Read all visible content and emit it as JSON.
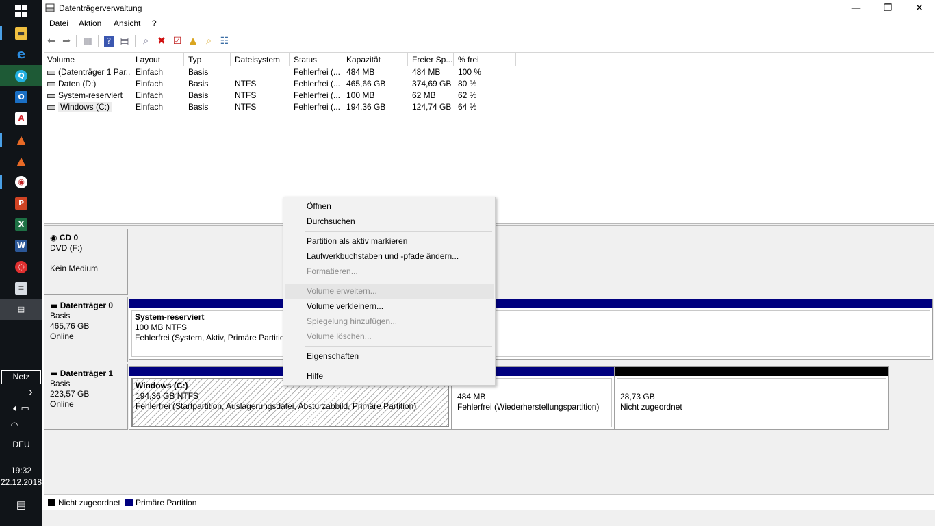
{
  "window": {
    "title": "Datenträgerverwaltung"
  },
  "menu": [
    "Datei",
    "Aktion",
    "Ansicht",
    "?"
  ],
  "list": {
    "columns": [
      "Volume",
      "Layout",
      "Typ",
      "Dateisystem",
      "Status",
      "Kapazität",
      "Freier Sp...",
      "% frei"
    ],
    "rows": [
      {
        "volume": "(Datenträger 1 Par...",
        "layout": "Einfach",
        "typ": "Basis",
        "fs": "",
        "status": "Fehlerfrei (...",
        "capacity": "484 MB",
        "free": "484 MB",
        "pct": "100 %"
      },
      {
        "volume": "Daten (D:)",
        "layout": "Einfach",
        "typ": "Basis",
        "fs": "NTFS",
        "status": "Fehlerfrei (...",
        "capacity": "465,66 GB",
        "free": "374,69 GB",
        "pct": "80 %"
      },
      {
        "volume": "System-reserviert",
        "layout": "Einfach",
        "typ": "Basis",
        "fs": "NTFS",
        "status": "Fehlerfrei (...",
        "capacity": "100 MB",
        "free": "62 MB",
        "pct": "62 %"
      },
      {
        "volume": "Windows (C:)",
        "layout": "Einfach",
        "typ": "Basis",
        "fs": "NTFS",
        "status": "Fehlerfrei (...",
        "capacity": "194,36 GB",
        "free": "124,74 GB",
        "pct": "64 %"
      }
    ]
  },
  "disks": {
    "cd0": {
      "name": "CD 0",
      "type": "DVD (F:)",
      "status": "Kein Medium"
    },
    "disk0": {
      "name": "Datenträger 0",
      "type": "Basis",
      "size": "465,76 GB",
      "status": "Online",
      "p1": {
        "name": "System-reserviert",
        "size": "100 MB NTFS",
        "status": "Fehlerfrei (System, Aktiv, Primäre Partition)"
      }
    },
    "disk1": {
      "name": "Datenträger 1",
      "type": "Basis",
      "size": "223,57 GB",
      "status": "Online",
      "p1": {
        "name": "Windows  (C:)",
        "size": "194,36 GB NTFS",
        "status": "Fehlerfrei (Startpartition, Auslagerungsdatei, Absturzabbild, Primäre Partition)"
      },
      "p2": {
        "size": "484 MB",
        "status": "Fehlerfrei (Wiederherstellungspartition)"
      },
      "p3": {
        "size": "28,73 GB",
        "status": "Nicht zugeordnet"
      }
    }
  },
  "legend": {
    "unallocated": "Nicht zugeordnet",
    "primary": "Primäre Partition"
  },
  "colors": {
    "primary": "#00007f",
    "unallocated": "#000000",
    "taskbar": "#101418"
  },
  "context_menu": {
    "items": [
      {
        "label": "Öffnen",
        "enabled": true
      },
      {
        "label": "Durchsuchen",
        "enabled": true
      },
      {
        "label": "Partition als aktiv markieren",
        "enabled": true
      },
      {
        "label": "Laufwerkbuchstaben und -pfade ändern...",
        "enabled": true
      },
      {
        "label": "Formatieren...",
        "enabled": false
      },
      {
        "label": "Volume erweitern...",
        "enabled": false,
        "highlighted": true
      },
      {
        "label": "Volume verkleinern...",
        "enabled": true
      },
      {
        "label": "Spiegelung hinzufügen...",
        "enabled": false
      },
      {
        "label": "Volume löschen...",
        "enabled": false
      },
      {
        "label": "Eigenschaften",
        "enabled": true
      },
      {
        "label": "Hilfe",
        "enabled": true
      }
    ]
  },
  "taskbar": {
    "network_label": "Netz",
    "language": "DEU",
    "time": "19:32",
    "date": "22.12.2018",
    "apps": [
      "windows-start-icon",
      "file-explorer-icon",
      "edge-icon",
      "app-q-icon",
      "outlook-icon",
      "acrobat-icon",
      "matlab-icon",
      "matlab-icon-2",
      "paint-icon",
      "powerpoint-icon",
      "excel-icon",
      "word-icon",
      "app-red-icon",
      "document-app-icon",
      "disk-management-icon"
    ]
  }
}
